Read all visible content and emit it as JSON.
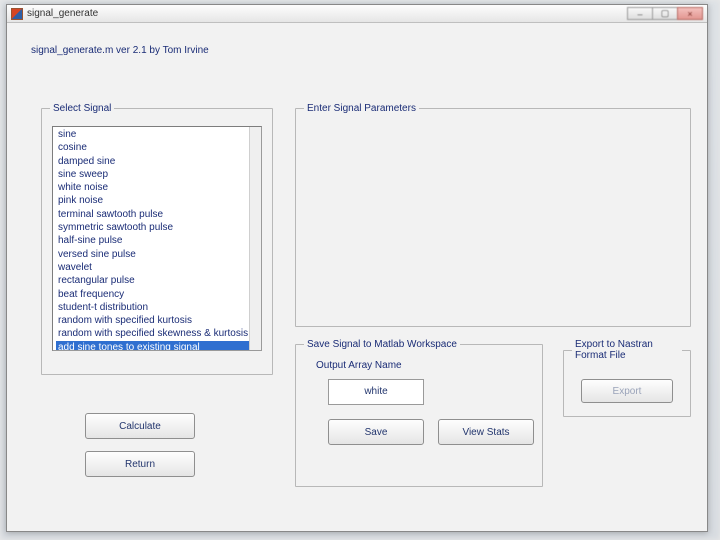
{
  "window": {
    "title": "signal_generate"
  },
  "script_line": "signal_generate.m  ver 2.1  by Tom Irvine",
  "select_signal": {
    "legend": "Select Signal",
    "items": [
      "sine",
      "cosine",
      "damped sine",
      "sine sweep",
      "white noise",
      "pink noise",
      "terminal sawtooth pulse",
      "symmetric sawtooth pulse",
      "half-sine pulse",
      "versed sine pulse",
      "wavelet",
      "rectangular pulse",
      "beat frequency",
      "student-t distribution",
      "random with specified kurtosis",
      "random with specified skewness & kurtosis",
      "add sine tones to existing signal"
    ],
    "selected_index": 16
  },
  "buttons": {
    "calculate": "Calculate",
    "return": "Return"
  },
  "parameters": {
    "legend": "Enter Signal Parameters"
  },
  "save_ws": {
    "legend": "Save Signal to Matlab Workspace",
    "output_label": "Output Array Name",
    "output_value": "white",
    "save": "Save",
    "view_stats": "View Stats"
  },
  "export_box": {
    "legend": "Export to Nastran Format File",
    "export": "Export"
  }
}
